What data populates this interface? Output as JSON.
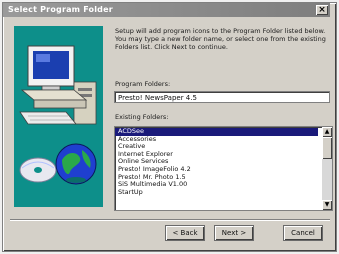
{
  "window": {
    "title": "Select Program Folder",
    "close_glyph": "×"
  },
  "intro_text": "Setup will add program icons to the Program Folder listed below. You may type a new folder name, or select one from the existing Folders list. Click Next to continue.",
  "program_folder": {
    "label": "Program Folders:",
    "value": "Presto! NewsPaper 4.5"
  },
  "existing_folders": {
    "label": "Existing Folders:",
    "items": [
      "ACDSee",
      "Accessories",
      "Creative",
      "Internet Explorer",
      "Online Services",
      "Presto! ImageFolio 4.2",
      "Presto! Mr. Photo 1.5",
      "SiS Multimedia V1.00",
      "StartUp"
    ],
    "selected_index": 0,
    "scroll_up_glyph": "▲",
    "scroll_down_glyph": "▼"
  },
  "buttons": {
    "back": "< Back",
    "next": "Next >",
    "cancel": "Cancel"
  },
  "colors": {
    "art_background": "#0d8f8a",
    "selection": "#1a1a7a"
  },
  "icons": [
    "computer-icon",
    "cd-icon",
    "globe-icon",
    "close-icon",
    "scroll-up-icon",
    "scroll-down-icon"
  ]
}
